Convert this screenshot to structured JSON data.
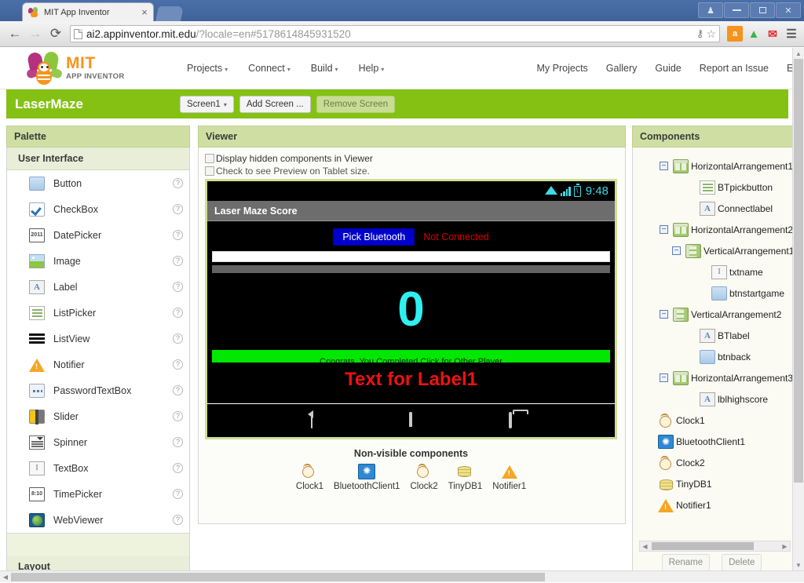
{
  "browser": {
    "tab_title": "MIT App Inventor",
    "tab_close": "×",
    "url_domain": "ai2.appinventor.mit.edu",
    "url_path": "/?locale=en#5178614845931520",
    "back_icon": "←",
    "forward_icon": "→",
    "reload_icon": "⟳",
    "key_icon": "⚷",
    "star_icon": "☆",
    "menu_icon": "☰",
    "ext_amazon_label": "a",
    "ext_green_label": "▲",
    "ext_red_label": "✉",
    "win_user_icon": "♟",
    "win_close_icon": "✕"
  },
  "appheader": {
    "logo_mit": "MIT",
    "logo_sub": "APP INVENTOR",
    "nav_left": [
      {
        "label": "Projects",
        "caret": "▾"
      },
      {
        "label": "Connect",
        "caret": "▾"
      },
      {
        "label": "Build",
        "caret": "▾"
      },
      {
        "label": "Help",
        "caret": "▾"
      }
    ],
    "nav_right": [
      {
        "label": "My Projects"
      },
      {
        "label": "Gallery"
      },
      {
        "label": "Guide"
      },
      {
        "label": "Report an Issue"
      },
      {
        "label": "English"
      }
    ]
  },
  "projectbar": {
    "project_name": "LaserMaze",
    "screen_selector": "Screen1",
    "screen_caret": "▾",
    "add_screen": "Add Screen ...",
    "remove_screen": "Remove Screen",
    "accent_color": "#84c113"
  },
  "palette": {
    "header": "Palette",
    "sections": [
      {
        "title": "User Interface",
        "items": [
          {
            "label": "Button",
            "icon": "button-icon",
            "help": "?"
          },
          {
            "label": "CheckBox",
            "icon": "checkbox-icon",
            "help": "?"
          },
          {
            "label": "DatePicker",
            "icon": "datepicker-icon",
            "help": "?"
          },
          {
            "label": "Image",
            "icon": "image-icon",
            "help": "?"
          },
          {
            "label": "Label",
            "icon": "label-icon",
            "help": "?"
          },
          {
            "label": "ListPicker",
            "icon": "listpicker-icon",
            "help": "?"
          },
          {
            "label": "ListView",
            "icon": "listview-icon",
            "help": "?"
          },
          {
            "label": "Notifier",
            "icon": "notifier-icon",
            "help": "?"
          },
          {
            "label": "PasswordTextBox",
            "icon": "passwordtextbox-icon",
            "help": "?"
          },
          {
            "label": "Slider",
            "icon": "slider-icon",
            "help": "?"
          },
          {
            "label": "Spinner",
            "icon": "spinner-icon",
            "help": "?"
          },
          {
            "label": "TextBox",
            "icon": "textbox-icon",
            "help": "?"
          },
          {
            "label": "TimePicker",
            "icon": "timepicker-icon",
            "help": "?"
          },
          {
            "label": "WebViewer",
            "icon": "webviewer-icon",
            "help": "?"
          }
        ]
      }
    ],
    "next_section": "Layout",
    "icon_glyph_date": "2011",
    "icon_glyph_time": "8:10",
    "icon_glyph_label": "A",
    "icon_glyph_textbox": "I"
  },
  "viewer": {
    "header": "Viewer",
    "checkbox_hidden": "Display hidden components in Viewer",
    "checkbox_tablet": "Check to see Preview on Tablet size.",
    "checkbox_hidden_checked": false,
    "checkbox_tablet_checked": false,
    "phone": {
      "status_time": "9:48",
      "status_accent": "#2ff0f0",
      "title": "Laser Maze Score",
      "bt_button": "Pick Bluetooth",
      "bt_button_color": "#0000cd",
      "connect_label": "Not Connected",
      "connect_label_color": "#d40000",
      "score": "0",
      "score_color": "#2ff0f0",
      "green_button": "Congrats, You Completed Click for Other Player",
      "green_button_color": "#00e800",
      "red_label": "Text for Label1",
      "red_label_color": "#ef1111"
    },
    "nonvisible_title": "Non-visible components",
    "nonvisible": [
      {
        "label": "Clock1",
        "icon": "clock-icon"
      },
      {
        "label": "BluetoothClient1",
        "icon": "bluetooth-icon"
      },
      {
        "label": "Clock2",
        "icon": "clock-icon"
      },
      {
        "label": "TinyDB1",
        "icon": "database-icon"
      },
      {
        "label": "Notifier1",
        "icon": "notifier-icon"
      }
    ]
  },
  "components": {
    "header": "Components",
    "tree": [
      {
        "label": "HorizontalArrangement1",
        "icon": "horizontal-arrangement-icon",
        "indent": 1,
        "toggle": "−"
      },
      {
        "label": "BTpickbutton",
        "icon": "listpicker-icon",
        "indent": 2,
        "toggle": null
      },
      {
        "label": "Connectlabel",
        "icon": "label-icon",
        "indent": 2,
        "toggle": null
      },
      {
        "label": "HorizontalArrangement2",
        "icon": "horizontal-arrangement-icon",
        "indent": 1,
        "toggle": "−"
      },
      {
        "label": "VerticalArrangement1",
        "icon": "vertical-arrangement-icon",
        "indent": 2,
        "toggle": "−"
      },
      {
        "label": "txtname",
        "icon": "textbox-icon",
        "indent": 3,
        "toggle": null
      },
      {
        "label": "btnstartgame",
        "icon": "button-icon",
        "indent": 3,
        "toggle": null
      },
      {
        "label": "VerticalArrangement2",
        "icon": "vertical-arrangement-icon",
        "indent": 1,
        "toggle": "−"
      },
      {
        "label": "BTlabel",
        "icon": "label-icon",
        "indent": 2,
        "toggle": null
      },
      {
        "label": "btnback",
        "icon": "button-icon",
        "indent": 2,
        "toggle": null
      },
      {
        "label": "HorizontalArrangement3",
        "icon": "horizontal-arrangement-icon",
        "indent": 1,
        "toggle": "−"
      },
      {
        "label": "lblhighscore",
        "icon": "label-icon",
        "indent": 2,
        "toggle": null
      },
      {
        "label": "Clock1",
        "icon": "clock-icon",
        "indent": 0,
        "toggle": null
      },
      {
        "label": "BluetoothClient1",
        "icon": "bluetooth-icon",
        "indent": 0,
        "toggle": null
      },
      {
        "label": "Clock2",
        "icon": "clock-icon",
        "indent": 0,
        "toggle": null
      },
      {
        "label": "TinyDB1",
        "icon": "database-icon",
        "indent": 0,
        "toggle": null
      },
      {
        "label": "Notifier1",
        "icon": "notifier-icon",
        "indent": 0,
        "toggle": null
      }
    ],
    "rename_button": "Rename",
    "delete_button": "Delete",
    "scroll_up": "▲",
    "scroll_down": "▼",
    "scroll_left": "◀",
    "scroll_right": "▶"
  }
}
